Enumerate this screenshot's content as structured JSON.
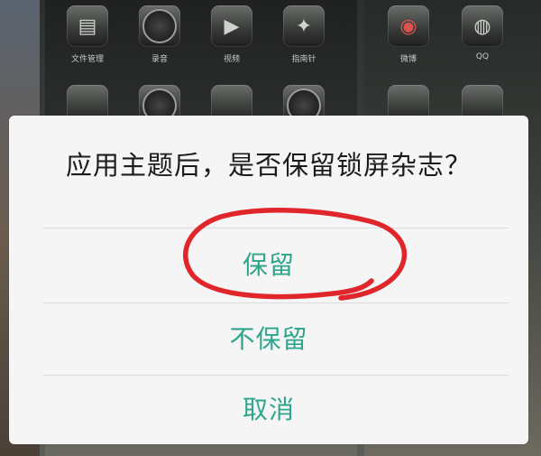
{
  "home_screen": {
    "apps": [
      {
        "label": "文件管理",
        "icon": "file-manager-icon",
        "glyph": "▤"
      },
      {
        "label": "录音",
        "icon": "recorder-icon",
        "glyph": ""
      },
      {
        "label": "视频",
        "icon": "video-icon",
        "glyph": "▶"
      },
      {
        "label": "指南针",
        "icon": "compass-icon",
        "glyph": "✦"
      },
      {
        "label": "微博",
        "icon": "weibo-icon",
        "glyph": "◉"
      },
      {
        "label": "QQ",
        "icon": "qq-icon",
        "glyph": "◍"
      }
    ]
  },
  "dialog": {
    "title": "应用主题后，是否保留锁屏杂志？",
    "options": {
      "keep": "保留",
      "discard": "不保留",
      "cancel": "取消"
    },
    "accent_color": "#2fa58c"
  },
  "annotation": {
    "icon": "red-circle-highlight",
    "color": "#e0262a"
  }
}
